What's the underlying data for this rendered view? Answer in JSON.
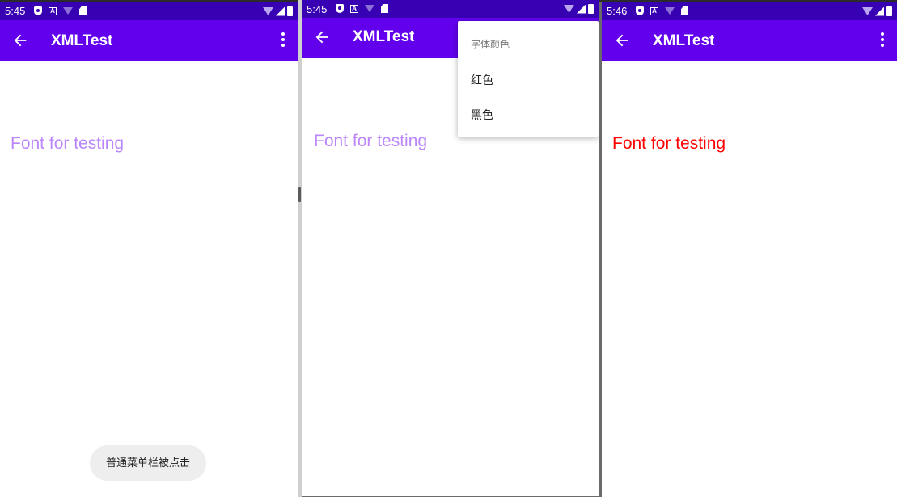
{
  "screens": [
    {
      "status": {
        "time": "5:45"
      },
      "appbar": {
        "title": "XMLTest"
      },
      "sample_text": "Font for testing",
      "sample_color": "#bb86fc",
      "toast": "普通菜单栏被点击"
    },
    {
      "status": {
        "time": "5:45"
      },
      "appbar": {
        "title": "XMLTest"
      },
      "sample_text": "Font for testing",
      "sample_color": "#bb86fc",
      "popup_menu": {
        "header": "字体颜色",
        "items": [
          {
            "label": "红色"
          },
          {
            "label": "黑色"
          }
        ]
      }
    },
    {
      "status": {
        "time": "5:46"
      },
      "appbar": {
        "title": "XMLTest"
      },
      "sample_text": "Font for testing",
      "sample_color": "#ff0000"
    }
  ],
  "colors": {
    "status_bar": "#3700b3",
    "app_bar": "#6200ee",
    "toast_bg": "#eeeeee"
  },
  "icons": [
    "back-arrow-icon",
    "overflow-menu-icon",
    "vpn-shield-icon",
    "a-notification-icon",
    "wifi-icon",
    "sd-card-icon",
    "signal-icon",
    "battery-icon"
  ]
}
